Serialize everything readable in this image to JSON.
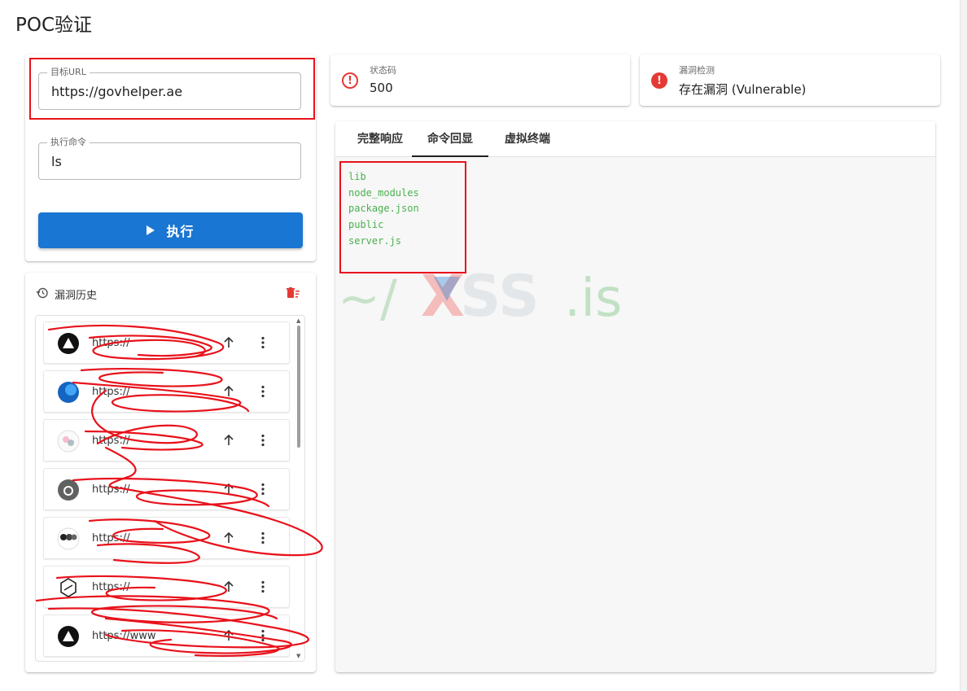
{
  "page": {
    "title": "POC验证"
  },
  "form": {
    "target_url": {
      "label": "目标URL",
      "value": "https://govhelper.ae"
    },
    "command": {
      "label": "执行命令",
      "value": "ls"
    },
    "execute_label": "执行"
  },
  "status_cards": [
    {
      "label": "状态码",
      "value": "500",
      "icon": "error-outline-icon"
    },
    {
      "label": "漏洞检测",
      "value": "存在漏洞 (Vulnerable)",
      "icon": "error-filled-icon"
    }
  ],
  "tabs": [
    {
      "label": "完整响应",
      "active": false
    },
    {
      "label": "命令回显",
      "active": true
    },
    {
      "label": "虚拟终端",
      "active": false
    }
  ],
  "console": {
    "lines": [
      "lib",
      "node_modules",
      "package.json",
      "public",
      "server.js"
    ]
  },
  "history": {
    "title": "漏洞历史",
    "items": [
      {
        "url": "https://",
        "logo": "triangle-logo-icon"
      },
      {
        "url": "https://",
        "logo": "blue-circle-logo-icon"
      },
      {
        "url": "https://",
        "logo": "cartoon-logo-icon"
      },
      {
        "url": "https://",
        "logo": "grey-circle-logo-icon"
      },
      {
        "url": "https://",
        "logo": "dark-dots-logo-icon"
      },
      {
        "url": "https://",
        "logo": "hexagon-logo-icon"
      },
      {
        "url": "https://www",
        "logo": "triangle-logo-icon"
      }
    ]
  },
  "colors": {
    "primary": "#1976d2",
    "error": "#e53935",
    "console_text": "#4caf50",
    "annotation": "#e8121b"
  }
}
